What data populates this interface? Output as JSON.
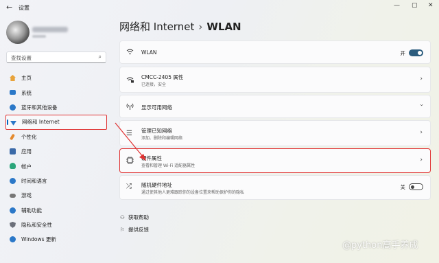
{
  "window": {
    "title": "设置",
    "back_icon": "back-arrow-icon",
    "controls": [
      "—",
      "▢",
      "✕"
    ]
  },
  "search": {
    "placeholder": "查找设置"
  },
  "sidebar": {
    "items": [
      {
        "label": "主页",
        "icon": "home-icon",
        "color": "#e8a33b"
      },
      {
        "label": "系统",
        "icon": "system-icon",
        "color": "#2b78c8"
      },
      {
        "label": "蓝牙和其他设备",
        "icon": "bluetooth-icon",
        "color": "#2b78c8"
      },
      {
        "label": "网络和 Internet",
        "icon": "network-icon",
        "color": "#2b78c8",
        "active": true
      },
      {
        "label": "个性化",
        "icon": "brush-icon",
        "color": "#e48a2e"
      },
      {
        "label": "应用",
        "icon": "apps-icon",
        "color": "#3b6aa8"
      },
      {
        "label": "帐户",
        "icon": "account-icon",
        "color": "#2ca67b"
      },
      {
        "label": "时间和语言",
        "icon": "globe-icon",
        "color": "#2b78c8"
      },
      {
        "label": "游戏",
        "icon": "game-icon",
        "color": "#777"
      },
      {
        "label": "辅助功能",
        "icon": "accessibility-icon",
        "color": "#2b78c8"
      },
      {
        "label": "隐私和安全性",
        "icon": "shield-icon",
        "color": "#6b6f7a"
      },
      {
        "label": "Windows 更新",
        "icon": "update-icon",
        "color": "#2b78c8"
      }
    ]
  },
  "breadcrumb": {
    "parent": "网络和 Internet",
    "separator": "›",
    "current": "WLAN"
  },
  "cards": {
    "wlan": {
      "label": "WLAN",
      "toggle_label": "开",
      "toggle": true
    },
    "network": {
      "title": "CMCC-2405 属性",
      "subtitle": "已连接，安全"
    },
    "available": {
      "title": "显示可用网络"
    },
    "known": {
      "title": "管理已知网络",
      "subtitle": "添加、删除和编辑网络"
    },
    "hardware": {
      "title": "硬件属性",
      "subtitle": "查看和管理 Wi-Fi 适配器属性"
    },
    "random": {
      "title": "随机硬件地址",
      "subtitle": "通过使其他人更难跟踪你的设备位置来帮助保护你的隐私",
      "toggle_label": "关",
      "toggle": false
    }
  },
  "links": {
    "help": "获取帮助",
    "feedback": "提供反馈"
  },
  "watermark": "@python高手养成",
  "colors": {
    "accent": "#2c5d7e",
    "highlight": "#e03131"
  }
}
